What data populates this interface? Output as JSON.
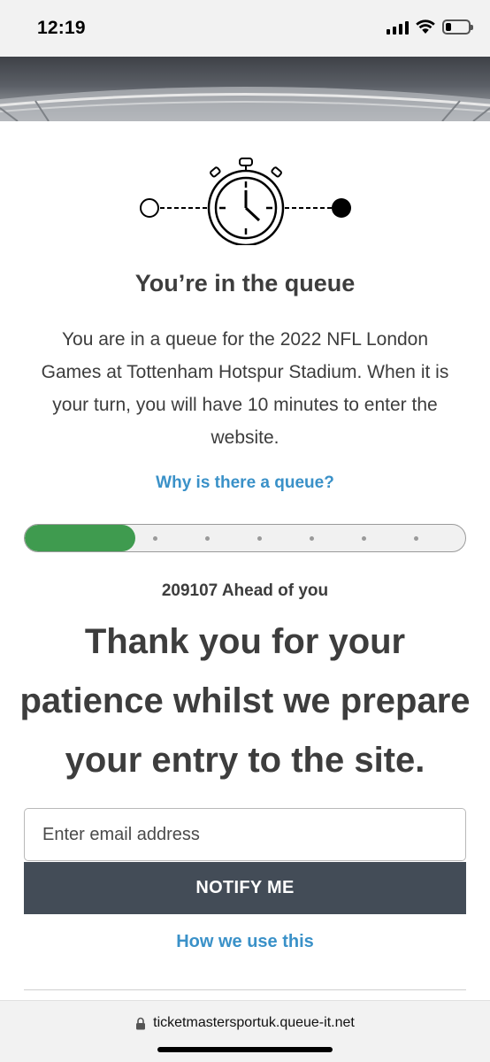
{
  "status_bar": {
    "time": "12:19",
    "icons": [
      "signal-icon",
      "wifi-icon",
      "battery-icon"
    ],
    "battery_level": 0.25
  },
  "queue_graphic": {
    "icons": [
      "start-circle-icon",
      "stopwatch-icon",
      "end-circle-icon"
    ]
  },
  "content": {
    "title": "You’re in the queue",
    "description_lines": [
      "You are in a queue for the 2022 NFL London",
      "Games at Tottenham Hotspur Stadium. When it is",
      "your turn, you will have 10 minutes to enter the",
      "website."
    ],
    "why_link": "Why is there a queue?",
    "progress": 0.25,
    "ahead_count": "209107",
    "ahead_label": "Ahead of you",
    "headline_lines": [
      "Thank you for your",
      "patience whilst we prepare",
      "your entry to the site."
    ]
  },
  "notify_form": {
    "email_placeholder": "Enter email address",
    "email_value": "",
    "button_label": "NOTIFY ME",
    "how_link": "How we use this"
  },
  "browser": {
    "url": "ticketmastersportuk.queue-it.net"
  },
  "colors": {
    "progress_fill": "#3f9b4f",
    "link": "#3a91c8",
    "button_bg": "#434c57",
    "text": "#3d3d3d"
  }
}
